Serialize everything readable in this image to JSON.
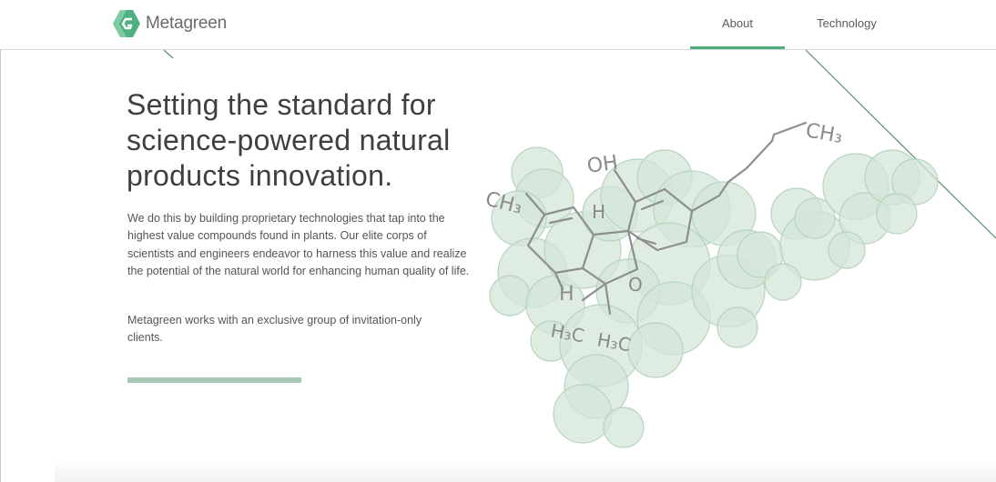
{
  "brand": {
    "name": "Metagreen",
    "logo_icon": "metagreen-logo-icon",
    "accent_color": "#4caf7a"
  },
  "nav": {
    "items": [
      {
        "label": "About",
        "active": true
      },
      {
        "label": "Technology",
        "active": false
      }
    ]
  },
  "hero": {
    "title_lines": [
      "Setting the standard for",
      "science-powered natural",
      "products innovation."
    ],
    "paragraph_1": "We do this by building proprietary technologies that tap into the highest value compounds found in plants. Our elite corps of scientists and engineers endeavor to harness this value and realize the potential of the natural world for enhancing human quality of life.",
    "paragraph_2": "Metagreen works with an exclusive group of invitation-only clients."
  },
  "illustration": {
    "icon": "molecule-sketch-icon",
    "labels": [
      "OH",
      "CH3",
      "CH3",
      "H",
      "H",
      "H3C",
      "H3C",
      "O"
    ],
    "fill_color": "#cfe3d5"
  }
}
